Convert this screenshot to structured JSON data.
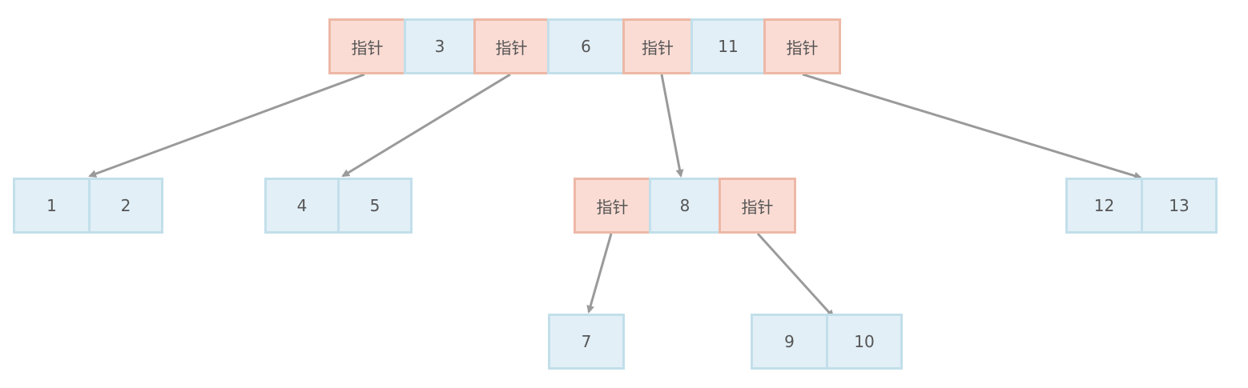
{
  "pointer_label": "指针",
  "colors": {
    "key_fill": "#e2eff7",
    "key_border": "#c2dfea",
    "pointer_fill": "#fadcd4",
    "pointer_border": "#edb8a6",
    "arrow": "#9a9a9a",
    "text": "#555555"
  },
  "nodes": [
    {
      "id": "root",
      "cells": [
        {
          "kind": "pointer",
          "text": "指针"
        },
        {
          "kind": "key",
          "text": "3"
        },
        {
          "kind": "pointer",
          "text": "指针"
        },
        {
          "kind": "key",
          "text": "6"
        },
        {
          "kind": "pointer",
          "text": "指针"
        },
        {
          "kind": "key",
          "text": "11"
        },
        {
          "kind": "pointer",
          "text": "指针"
        }
      ]
    },
    {
      "id": "leaf-1-2",
      "cells": [
        {
          "kind": "key",
          "text": "1"
        },
        {
          "kind": "key",
          "text": "2"
        }
      ]
    },
    {
      "id": "leaf-4-5",
      "cells": [
        {
          "kind": "key",
          "text": "4"
        },
        {
          "kind": "key",
          "text": "5"
        }
      ]
    },
    {
      "id": "inner-8",
      "cells": [
        {
          "kind": "pointer",
          "text": "指针"
        },
        {
          "kind": "key",
          "text": "8"
        },
        {
          "kind": "pointer",
          "text": "指针"
        }
      ]
    },
    {
      "id": "leaf-12-13",
      "cells": [
        {
          "kind": "key",
          "text": "12"
        },
        {
          "kind": "key",
          "text": "13"
        }
      ]
    },
    {
      "id": "leaf-7",
      "cells": [
        {
          "kind": "key",
          "text": "7"
        }
      ]
    },
    {
      "id": "leaf-9-10",
      "cells": [
        {
          "kind": "key",
          "text": "9"
        },
        {
          "kind": "key",
          "text": "10"
        }
      ]
    }
  ],
  "edges": [
    {
      "from": "root",
      "pointer_index": 0,
      "to": "leaf-1-2"
    },
    {
      "from": "root",
      "pointer_index": 2,
      "to": "leaf-4-5"
    },
    {
      "from": "root",
      "pointer_index": 4,
      "to": "inner-8"
    },
    {
      "from": "root",
      "pointer_index": 6,
      "to": "leaf-12-13"
    },
    {
      "from": "inner-8",
      "pointer_index": 0,
      "to": "leaf-7"
    },
    {
      "from": "inner-8",
      "pointer_index": 2,
      "to": "leaf-9-10"
    }
  ]
}
